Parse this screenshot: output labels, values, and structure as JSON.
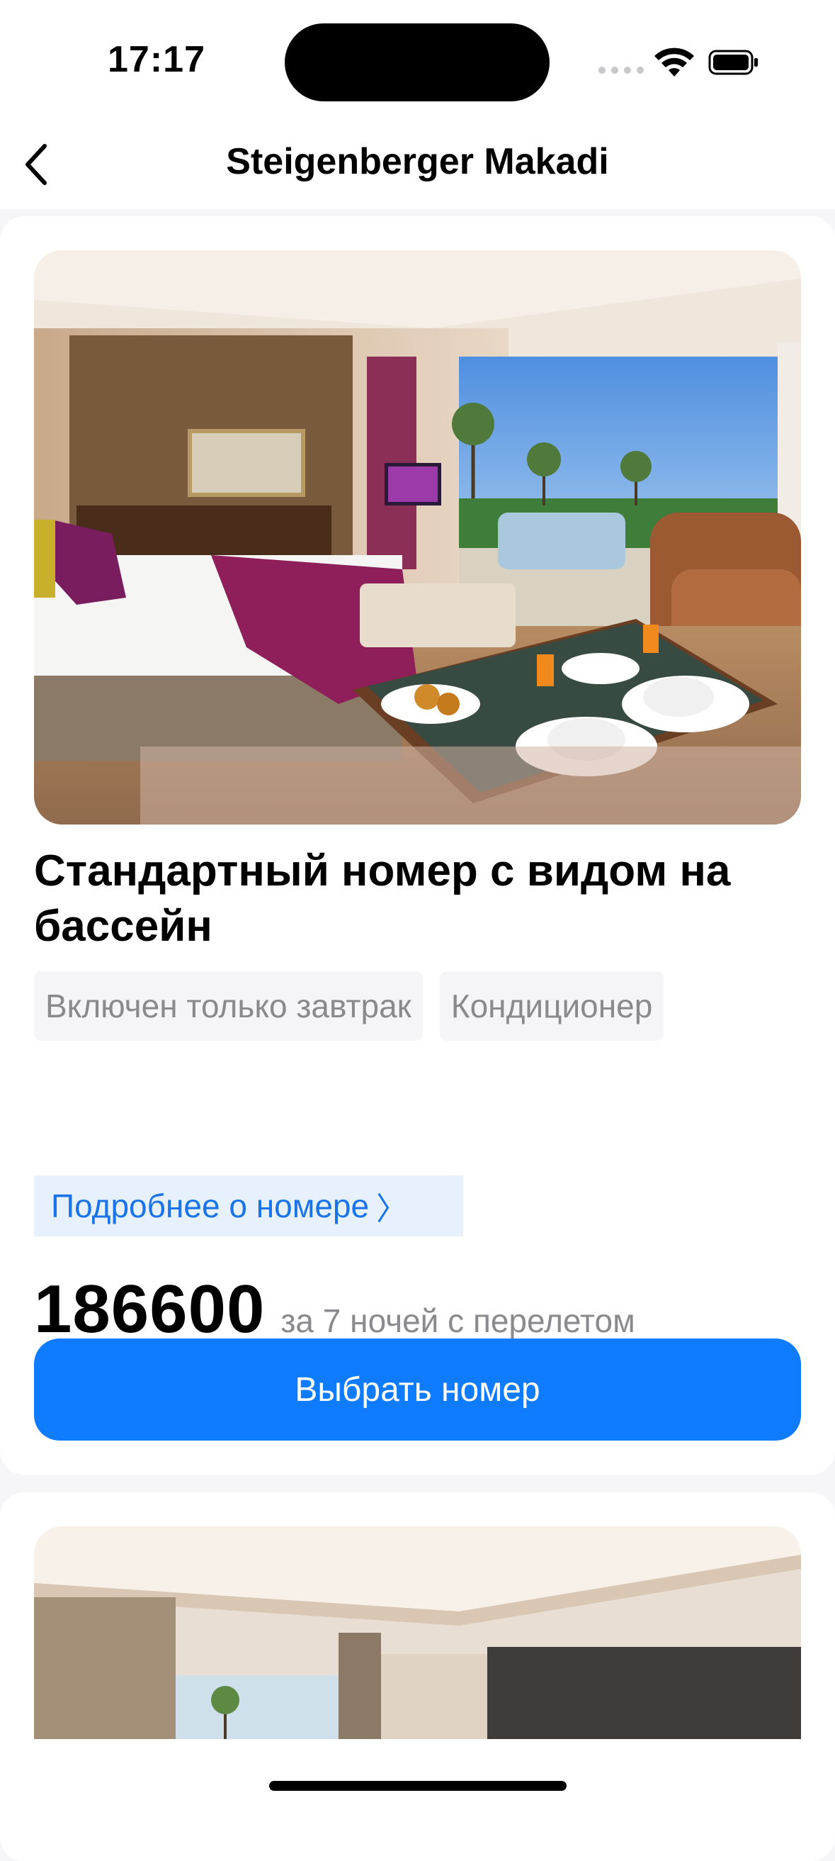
{
  "status_bar": {
    "time": "17:17"
  },
  "nav": {
    "title": "Steigenberger Makadi"
  },
  "rooms": [
    {
      "title": "Стандартный номер с видом на бассейн",
      "tags": [
        "Включен только завтрак",
        "Кондиционер"
      ],
      "details_label": "Подробнее о номере",
      "price": "186600",
      "price_note": "за 7 ночей с перелетом",
      "select_label": "Выбрать номер"
    }
  ],
  "colors": {
    "accent": "#0f7bff",
    "link_bg": "#e6f1fd",
    "link_text": "#1a74e8",
    "muted_text": "#8a8a8e",
    "tag_bg": "#f5f5f7"
  }
}
